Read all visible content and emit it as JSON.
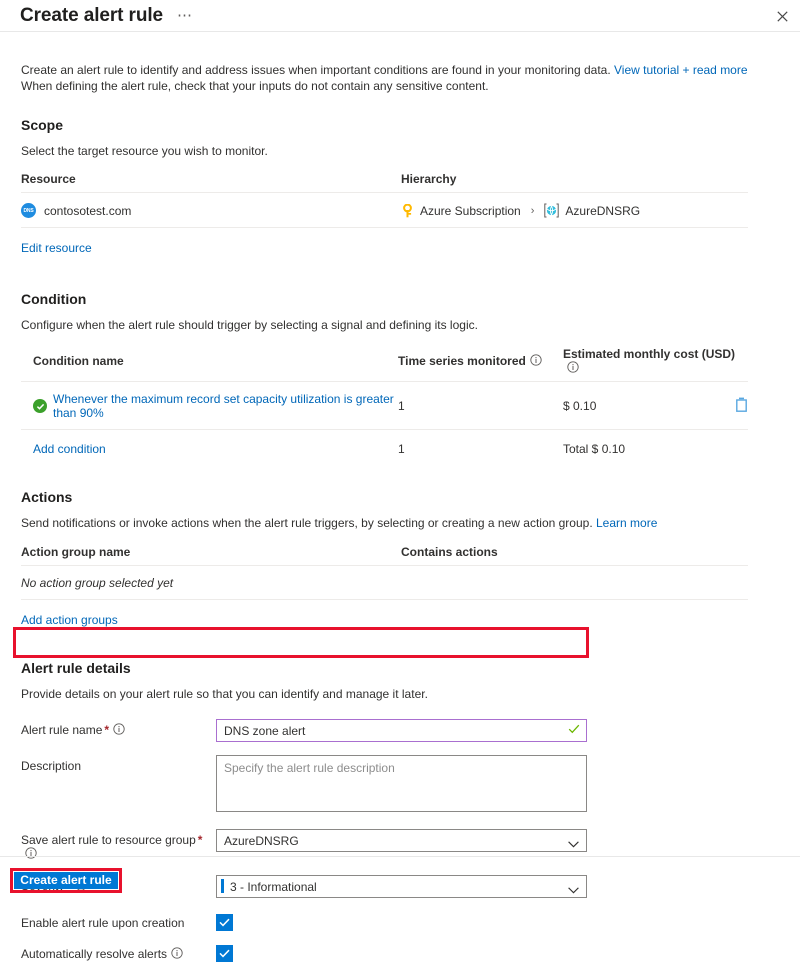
{
  "window": {
    "title": "Create alert rule",
    "more_label": "⋯",
    "close_icon": "close-icon"
  },
  "intro": {
    "line1_prefix": "Create an alert rule to identify and address issues when important conditions are found in your monitoring data. ",
    "line1_link": "View tutorial + read more",
    "line2": "When defining the alert rule, check that your inputs do not contain any sensitive content."
  },
  "scope": {
    "title": "Scope",
    "description": "Select the target resource you wish to monitor.",
    "columns": [
      "Resource",
      "Hierarchy"
    ],
    "row": {
      "resource_icon": "dns-zone-icon",
      "resource_icon_text": "DNS",
      "resource": "contosotest.com",
      "subscription_icon": "key-icon",
      "subscription": "Azure Subscription",
      "separator": "›",
      "resource_group_icon": "resource-group-icon",
      "resource_group": "AzureDNSRG"
    },
    "edit_link": "Edit resource"
  },
  "condition": {
    "title": "Condition",
    "description": "Configure when the alert rule should trigger by selecting a signal and defining its logic.",
    "columns": [
      "Condition name",
      "Time series monitored",
      "Estimated monthly cost (USD)"
    ],
    "row": {
      "status_icon": "green-check-icon",
      "name": "Whenever the maximum record set capacity utilization is greater than 90%",
      "time_series": "1",
      "cost": "$ 0.10",
      "delete_icon": "trash-icon"
    },
    "add_link": "Add condition",
    "total_time_series": "1",
    "total_cost": "Total $ 0.10"
  },
  "actions": {
    "title": "Actions",
    "description_prefix": "Send notifications or invoke actions when the alert rule triggers, by selecting or creating a new action group. ",
    "description_link": "Learn more",
    "columns": [
      "Action group name",
      "Contains actions"
    ],
    "empty_text": "No action group selected yet",
    "add_link": "Add action groups"
  },
  "details": {
    "title": "Alert rule details",
    "description": "Provide details on your alert rule so that you can identify and manage it later.",
    "fields": {
      "name": {
        "label": "Alert rule name",
        "required": "*",
        "info_icon": "info-icon",
        "value": "DNS zone alert",
        "valid_icon": "checkmark-icon"
      },
      "description": {
        "label": "Description",
        "value": "",
        "placeholder": "Specify the alert rule description"
      },
      "resource_group": {
        "label": "Save alert rule to resource group",
        "required": "*",
        "info_icon": "info-icon",
        "value": "AzureDNSRG",
        "chevron_icon": "chevron-down-icon"
      },
      "severity": {
        "label": "Severity",
        "required": "*",
        "info_icon": "info-icon",
        "value": "3 - Informational",
        "chevron_icon": "chevron-down-icon",
        "indicator_color": "#0078d4"
      },
      "enable": {
        "label": "Enable alert rule upon creation",
        "checked": true
      },
      "auto_resolve": {
        "label": "Automatically resolve alerts",
        "info_icon": "info-icon",
        "checked": true
      }
    }
  },
  "footer": {
    "create_button": "Create alert rule"
  },
  "colors": {
    "accent": "#0078d4",
    "link": "#0067b8",
    "highlight": "#e8112d",
    "success": "#3ba02b",
    "valid_border": "#a96fd0",
    "required": "#a4262c"
  }
}
